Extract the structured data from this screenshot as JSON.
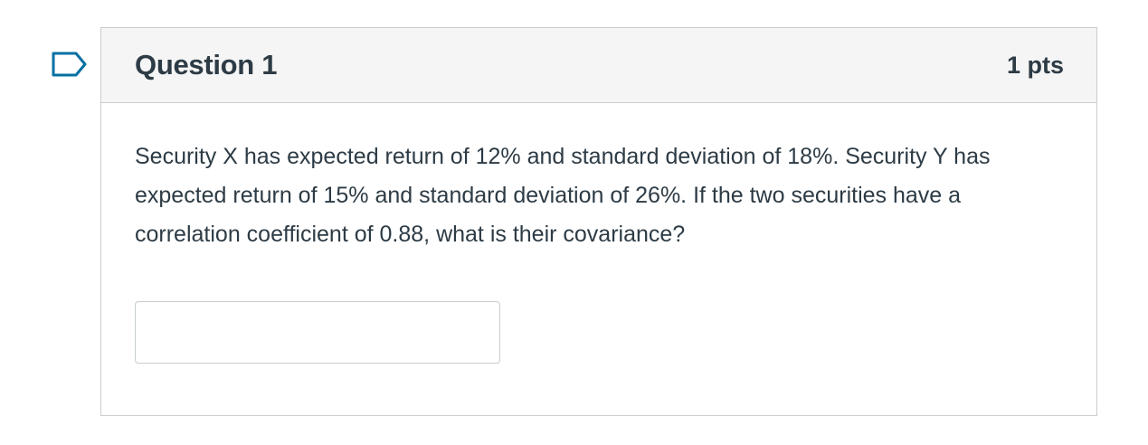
{
  "flag": {
    "icon": "flag-outline-icon",
    "color": "#0770a3"
  },
  "question": {
    "title": "Question 1",
    "points": "1 pts",
    "text": "Security X has expected return of 12% and standard deviation of 18%. Security Y has expected return of 15% and standard deviation of 26%. If the two securities have a correlation coefficient of 0.88, what is their covariance?",
    "answer": {
      "value": "",
      "placeholder": ""
    }
  },
  "colors": {
    "header_bg": "#f5f5f5",
    "border": "#c7cdd1",
    "text": "#2d3b45",
    "accent": "#0770a3"
  }
}
